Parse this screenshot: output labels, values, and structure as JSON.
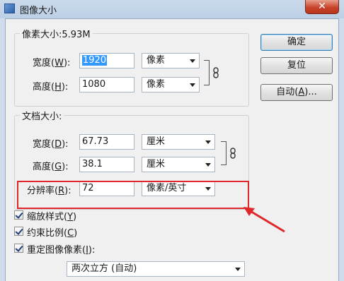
{
  "window": {
    "title": "图像大小",
    "close_glyph": "✕"
  },
  "pixel_dimensions": {
    "title": "像素大小:5.93M",
    "width_label": "宽度(",
    "width_key": "W",
    "width_tail": "):",
    "width_value": "1920",
    "width_unit": "像素",
    "height_label": "高度(",
    "height_key": "H",
    "height_tail": "):",
    "height_value": "1080",
    "height_unit": "像素"
  },
  "document_size": {
    "title": "文档大小:",
    "width_label": "宽度(",
    "width_key": "D",
    "width_tail": "):",
    "width_value": "67.73",
    "width_unit": "厘米",
    "height_label": "高度(",
    "height_key": "G",
    "height_tail": "):",
    "height_value": "38.1",
    "height_unit": "厘米",
    "resolution_label": "分辨率(",
    "resolution_key": "R",
    "resolution_tail": "):",
    "resolution_value": "72",
    "resolution_unit": "像素/英寸"
  },
  "buttons": {
    "ok": "确定",
    "reset": "复位",
    "auto_pre": "自动(",
    "auto_key": "A",
    "auto_post": ")..."
  },
  "options": {
    "scale_styles": {
      "pre": "缩放样式(",
      "key": "Y",
      "post": ")",
      "checked": true
    },
    "constrain": {
      "pre": "约束比例(",
      "key": "C",
      "post": ")",
      "checked": true
    },
    "resample": {
      "pre": "重定图像像素(",
      "key": "I",
      "post": "):",
      "checked": true
    },
    "resample_method": "两次立方 (自动)"
  },
  "colors": {
    "annotation": "#e0282c"
  },
  "icons": [
    "link-chain-icon",
    "dropdown-arrow-icon",
    "checkbox-check-icon",
    "close-icon",
    "app-icon"
  ]
}
